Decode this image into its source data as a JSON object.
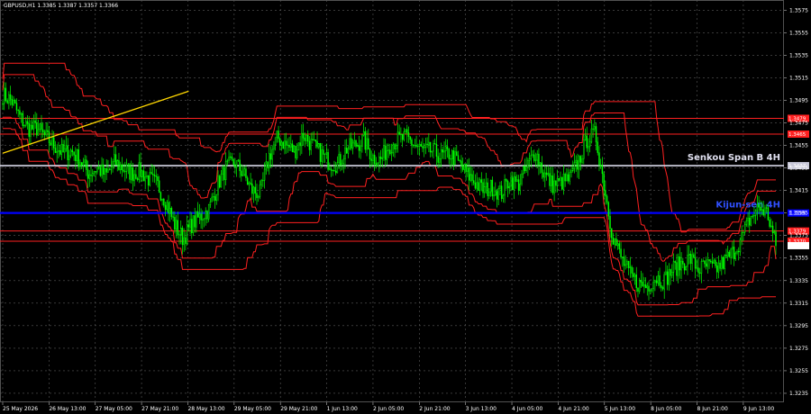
{
  "header": {
    "text": "GBPUSD,H1  1.3385 1.3387 1.3357 1.3366"
  },
  "colors": {
    "background": "#000000",
    "grid": "#5a5a5a",
    "candle_up": "#00ff00",
    "candle_down": "#00ff00",
    "ichimoku": "#ff2020",
    "trendline": "#ffd700",
    "kijun": "#0000ff",
    "senkou": "#d8d8e8",
    "level": "#ff2020"
  },
  "chart_data": {
    "type": "candlestick",
    "symbol": "GBPUSD",
    "timeframe": "H1",
    "ylim": [
      1.3227,
      1.3584
    ],
    "y_ticks": [
      "1.3575",
      "1.3555",
      "1.3535",
      "1.3515",
      "1.3495",
      "1.3475",
      "1.3455",
      "1.3435",
      "1.3415",
      "1.3395",
      "1.3375",
      "1.3355",
      "1.3335",
      "1.3315",
      "1.3295",
      "1.3275",
      "1.3255",
      "1.3235"
    ],
    "x_ticks": [
      "25 May 2026",
      "26 May 13:00",
      "27 May 05:00",
      "27 May 21:00",
      "28 May 13:00",
      "29 May 05:00",
      "29 May 21:00",
      "1 Jun 13:00",
      "2 Jun 05:00",
      "2 Jun 21:00",
      "3 Jun 13:00",
      "4 Jun 05:00",
      "4 Jun 21:00",
      "5 Jun 13:00",
      "8 Jun 05:00",
      "8 Jun 21:00",
      "9 Jun 13:00"
    ],
    "close_path": [
      1.35,
      1.3495,
      1.348,
      1.347,
      1.347,
      1.3462,
      1.3455,
      1.3448,
      1.345,
      1.3442,
      1.343,
      1.3435,
      1.3428,
      1.344,
      1.3435,
      1.343,
      1.3432,
      1.3425,
      1.342,
      1.3405,
      1.3385,
      1.3372,
      1.3385,
      1.3392,
      1.3398,
      1.342,
      1.3435,
      1.344,
      1.343,
      1.3415,
      1.3412,
      1.3445,
      1.3462,
      1.3455,
      1.345,
      1.3465,
      1.3455,
      1.3448,
      1.344,
      1.3438,
      1.3452,
      1.3455,
      1.346,
      1.3445,
      1.3442,
      1.3455,
      1.346,
      1.3462,
      1.3455,
      1.345,
      1.345,
      1.3445,
      1.3448,
      1.344,
      1.343,
      1.3422,
      1.3415,
      1.3418,
      1.3412,
      1.3425,
      1.342,
      1.3435,
      1.345,
      1.343,
      1.342,
      1.3422,
      1.3425,
      1.344,
      1.346,
      1.3465,
      1.342,
      1.3375,
      1.3355,
      1.334,
      1.3332,
      1.333,
      1.3338,
      1.3335,
      1.3345,
      1.335,
      1.3355,
      1.3345,
      1.3348,
      1.3345,
      1.3352,
      1.336,
      1.3372,
      1.339,
      1.34,
      1.3395,
      1.3366
    ],
    "candles_drawn": 500,
    "levels": [
      {
        "name": "Senkou Span B 4H",
        "price": 1.3437,
        "box": "1.3437",
        "color": "#d8d8e8",
        "label_color": "#e0e0f0"
      },
      {
        "name": "Kijun-sen 4H",
        "price": 1.3395,
        "box": "1.3395",
        "color": "#0000ff",
        "label_color": "#3050ff"
      },
      {
        "name": "level",
        "price": 1.3479,
        "box": "1.3479",
        "color": "#ff2020"
      },
      {
        "name": "level",
        "price": 1.3465,
        "box": "1.3465",
        "color": "#ff2020"
      },
      {
        "name": "level",
        "price": 1.3379,
        "box": "1.3379",
        "color": "#ff2020"
      },
      {
        "name": "level",
        "price": 1.337,
        "box": "1.3370",
        "color": "#ff2020"
      }
    ],
    "current_price": {
      "price": 1.3366,
      "box": "1.3366"
    },
    "trendline": {
      "from": {
        "x_index": 0,
        "y": 1.3448
      },
      "to": {
        "x_index": 120,
        "y": 1.3503
      }
    },
    "grid": true
  }
}
